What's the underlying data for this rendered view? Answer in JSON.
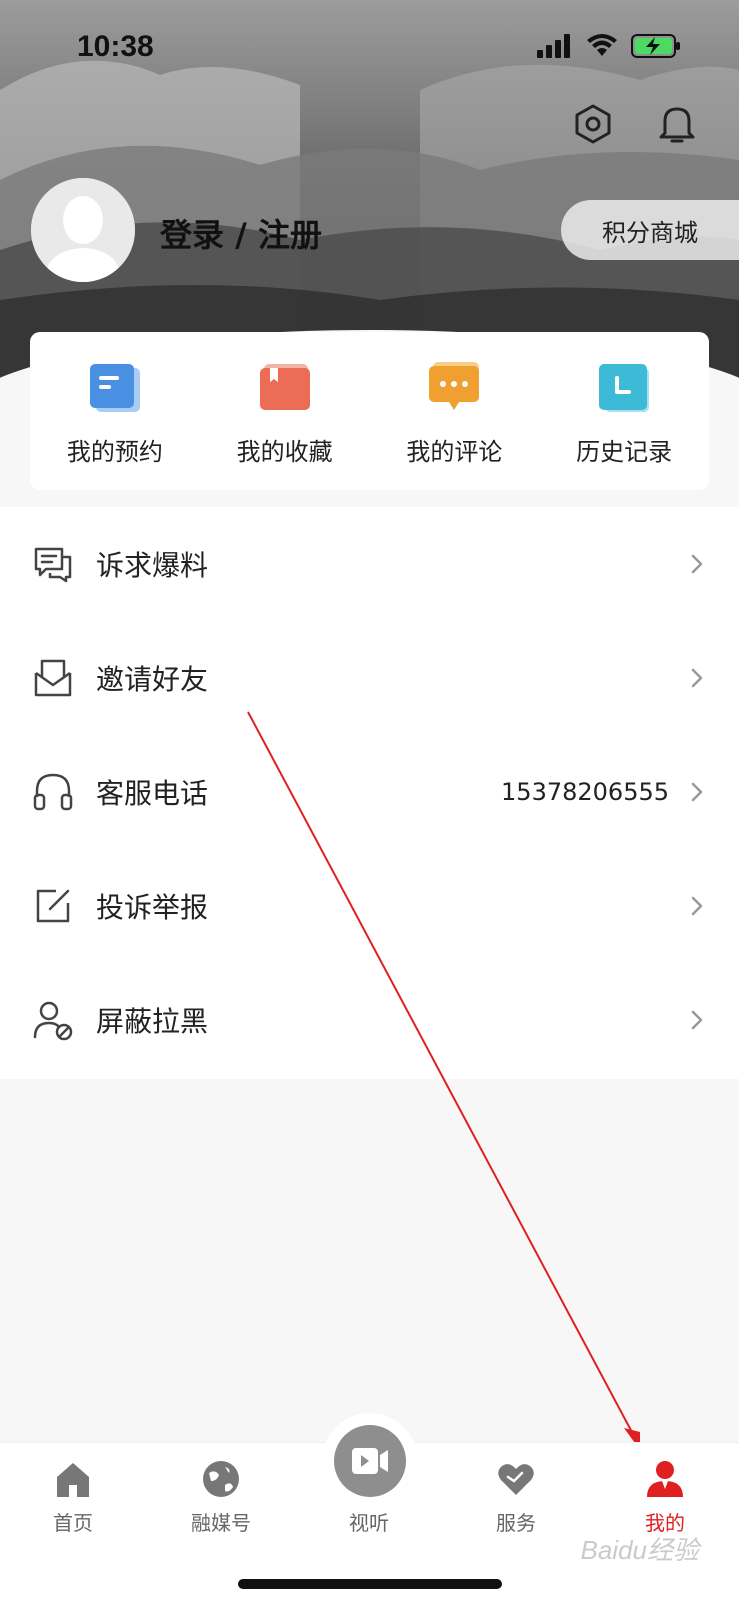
{
  "status_bar": {
    "time": "10:38"
  },
  "profile": {
    "login_label": "登录 / 注册",
    "points_mall_label": "积分商城"
  },
  "quick_actions": [
    {
      "label": "我的预约",
      "icon": "calendar-doc-icon",
      "color": "#4a90e2"
    },
    {
      "label": "我的收藏",
      "icon": "bookmark-book-icon",
      "color": "#ec6d56"
    },
    {
      "label": "我的评论",
      "icon": "comment-bubble-icon",
      "color": "#f0a030"
    },
    {
      "label": "历史记录",
      "icon": "history-clock-icon",
      "color": "#3dbbd6"
    }
  ],
  "menu": [
    {
      "label": "诉求爆料",
      "icon": "chat-report-icon",
      "value": ""
    },
    {
      "label": "邀请好友",
      "icon": "envelope-icon",
      "value": ""
    },
    {
      "label": "客服电话",
      "icon": "headset-icon",
      "value": "15378206555"
    },
    {
      "label": "投诉举报",
      "icon": "edit-icon",
      "value": ""
    },
    {
      "label": "屏蔽拉黑",
      "icon": "user-block-icon",
      "value": ""
    }
  ],
  "tabbar": {
    "items": [
      {
        "label": "首页",
        "icon": "home-icon"
      },
      {
        "label": "融媒号",
        "icon": "globe-icon"
      },
      {
        "label": "视听",
        "icon": "video-play-icon"
      },
      {
        "label": "服务",
        "icon": "heart-icon"
      },
      {
        "label": "我的",
        "icon": "person-icon"
      }
    ],
    "active_color": "#e02020"
  },
  "watermark": "Baidu经验"
}
